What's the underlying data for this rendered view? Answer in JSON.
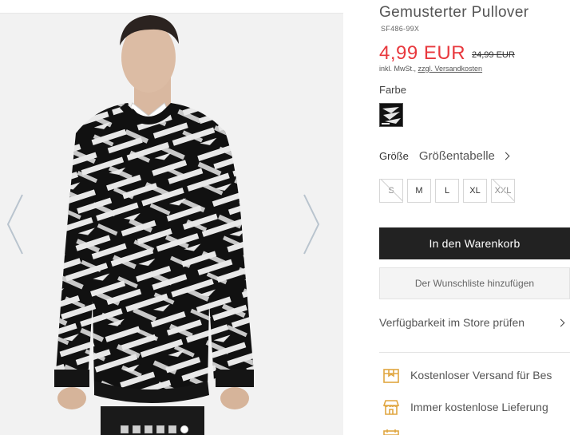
{
  "product": {
    "title": "Gemusterter Pullover",
    "sku": "SF486-99X",
    "price": "4,99 EUR",
    "old_price": "24,99 EUR",
    "tax_prefix": "inkl. MwSt., ",
    "shipping_link": "zzgl. Versandkosten"
  },
  "color": {
    "label": "Farbe",
    "swatch_icon": "zigzag-pattern-swatch"
  },
  "size": {
    "label": "Größe",
    "chart_link": "Größentabelle",
    "options": [
      {
        "label": "S",
        "available": false
      },
      {
        "label": "M",
        "available": true
      },
      {
        "label": "L",
        "available": true
      },
      {
        "label": "XL",
        "available": true
      },
      {
        "label": "XXL",
        "available": false
      }
    ]
  },
  "actions": {
    "add_to_cart": "In den Warenkorb",
    "add_to_wishlist": "Der Wunschliste hinzufügen",
    "store_availability": "Verfügbarkeit im Store prüfen"
  },
  "benefits": [
    {
      "icon": "package-icon",
      "text": "Kostenloser Versand für Bes"
    },
    {
      "icon": "store-icon",
      "text": "Immer kostenlose Lieferung"
    }
  ],
  "gallery": {
    "image_count": 6,
    "active_index": 6
  },
  "colors": {
    "price": "#e8383d",
    "cart_button": "#222222",
    "icon_accent": "#e0a640"
  }
}
